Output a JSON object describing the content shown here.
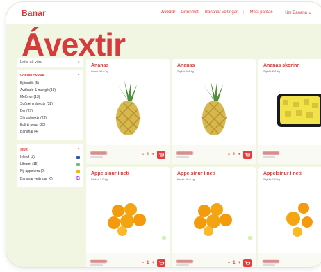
{
  "header": {
    "logo": "Banar",
    "nav": [
      {
        "label": "Ávextir",
        "active": true
      },
      {
        "label": "Grænmeti",
        "active": false
      },
      {
        "label": "Bananar veitingar",
        "active": false
      },
      {
        "label": "Mest pantað",
        "active": false
      },
      {
        "label": "Um Banana ⌄",
        "active": false
      }
    ]
  },
  "hero": {
    "title": "Ávextir"
  },
  "sidebar": {
    "search_placeholder": "Leita að vöru",
    "categories_heading": "VÖRUFLOKKAR",
    "categories": [
      "Bjórsalöt (5)",
      "Avókadó & mangó (10)",
      "Melónur (13)",
      "Suðrænir ávextir (32)",
      "Ber (27)",
      "Sítrusávextir (23)",
      "Epli & perur (25)",
      "Bananar (4)"
    ],
    "origin_heading": "SÍUR",
    "origin_items": [
      {
        "label": "Ísland (4)",
        "color": "#2d5aa8"
      },
      {
        "label": "Lífrænt (15)",
        "color": "#6cc36e"
      },
      {
        "label": "Ný uppskera (2)",
        "color": "#f2b500"
      },
      {
        "label": "Bananar veitingar (6)",
        "color": "#9b36ff"
      }
    ]
  },
  "products": [
    {
      "name": "Ananas",
      "sub": "Kassi: 11.0 kg",
      "image": "pineapple"
    },
    {
      "name": "Ananas",
      "sub": "Stykki: 1.6 kg",
      "image": "pineapple"
    },
    {
      "name": "Ananas skorinn",
      "sub": "Stykki: 2.2 kg",
      "image": "cut"
    },
    {
      "name": "Appelsínur í neti",
      "sub": "Stykki: 1.0 kg",
      "image": "oranges"
    },
    {
      "name": "Appelsínur í neti",
      "sub": "Kassi: 10.0 kg",
      "image": "oranges"
    },
    {
      "name": "Appelsínur í neti",
      "sub": "Stykki: 1.0 kg",
      "image": "oranges2"
    }
  ]
}
